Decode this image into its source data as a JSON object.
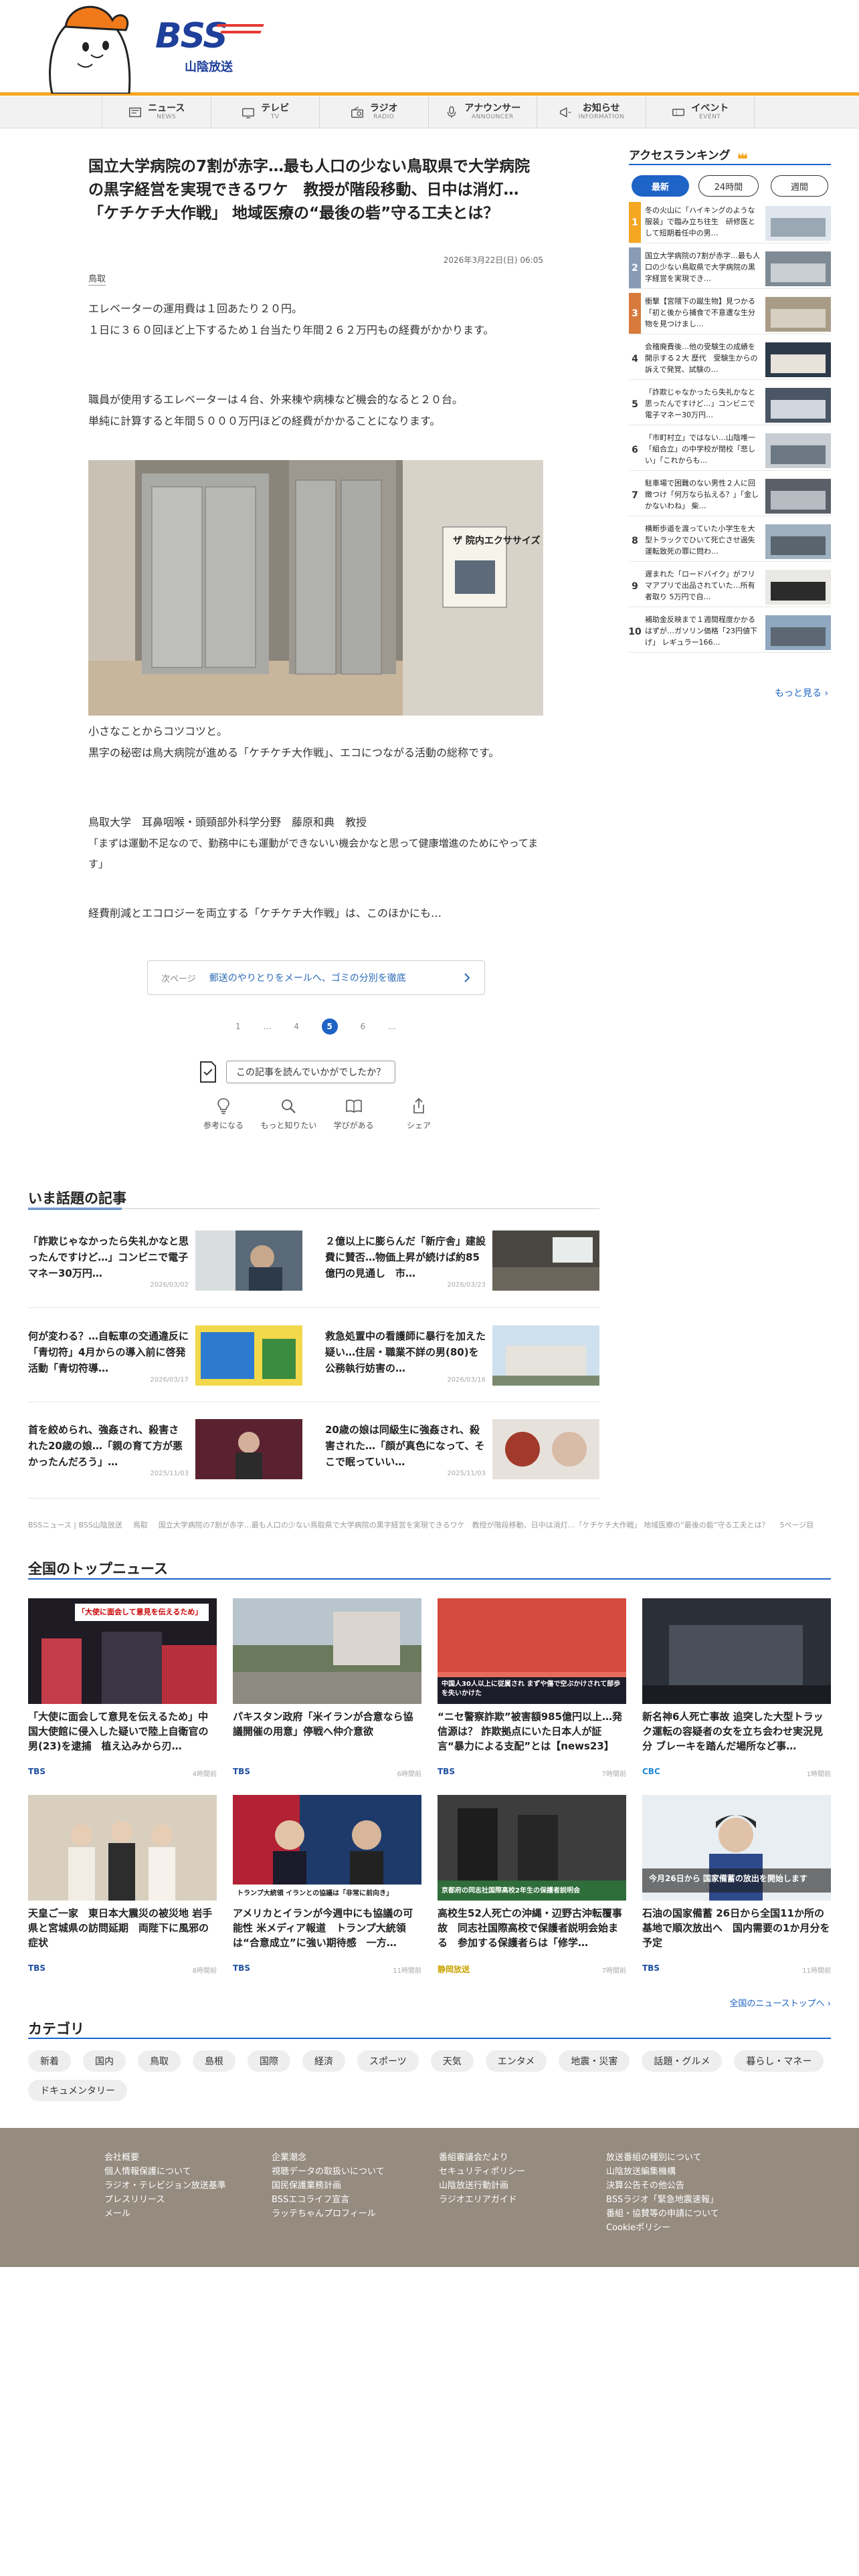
{
  "brand": {
    "name": "BSS",
    "sub": "山陰放送"
  },
  "nav": [
    {
      "label": "ニュース",
      "sub": "NEWS",
      "icon": "news-icon"
    },
    {
      "label": "テレビ",
      "sub": "TV",
      "icon": "tv-icon"
    },
    {
      "label": "ラジオ",
      "sub": "RADIO",
      "icon": "radio-icon"
    },
    {
      "label": "アナウンサー",
      "sub": "ANNOUNCER",
      "icon": "microphone-icon"
    },
    {
      "label": "お知らせ",
      "sub": "INFORMATION",
      "icon": "megaphone-icon"
    },
    {
      "label": "イベント",
      "sub": "EVENT",
      "icon": "ticket-icon"
    }
  ],
  "article": {
    "headline": "国立大学病院の7割が赤字…最も人口の少ない鳥取県で大学病院の黒字経営を実現できるワケ　教授が階段移動、日中は消灯…「ケチケチ大作戦」 地域医療の“最後の砦”守る工夫とは？",
    "date": "2026年3月22日(日) 06:05",
    "tag": "鳥取",
    "paragraphs": [
      "エレベーターの運用費は１回あたり２０円。",
      "１日に３６０回ほど上下するため１台当たり年間２６２万円もの経費がかかります。",
      "職員が使用するエレベーターは４台、外来棟や病棟など機会的なると２０台。",
      "単純に計算すると年間５０００万円ほどの経費がかかることになります。",
      "小さなことからコツコツと。",
      "黒字の秘密は鳥大病院が進める「ケチケチ大作戦」、エコにつながる活動の総称です。",
      "鳥取大学　耳鼻咽喉・頭頸部外科学分野　藤原和典　教授",
      "「まずは運動不足なので、勤務中にも運動ができないい機会かなと思って健康増進のためにやってます」",
      "経費削減とエコロジーを両立する「ケチケチ大作戦」は、このほかにも…"
    ],
    "photo_sign": "ザ 院内エクササイズ",
    "next_label": "次ページ",
    "next_title": "郵送のやりとりをメールへ、ゴミの分別を徹底",
    "pages": [
      "1",
      "…",
      "4",
      "5",
      "6",
      "…"
    ],
    "current_page": "5",
    "feedback_question": "この記事を読んでいかがでしたか？",
    "feedback": [
      {
        "label": "参考になる",
        "icon": "lightbulb-icon"
      },
      {
        "label": "もっと知りたい",
        "icon": "magnifier-icon"
      },
      {
        "label": "学びがある",
        "icon": "book-icon"
      },
      {
        "label": "シェア",
        "icon": "share-icon"
      }
    ]
  },
  "trending": {
    "title": "いま話題の記事",
    "items": [
      {
        "title": "「詐欺じゃなかったら失礼かなと思ったんですけど…」コンビニで電子マネー30万円…",
        "date": "2026/03/02"
      },
      {
        "title": "２億以上に膨らんだ「新庁舎」建設費に賛否…物価上昇が続けば約85億円の見通し　市…",
        "date": "2026/03/23"
      },
      {
        "title": "何が変わる？…自転車の交通違反に「青切符」4月からの導入前に啓発活動「青切符導…",
        "date": "2026/03/17"
      },
      {
        "title": "救急処置中の看護師に暴行を加えた疑い…住居・職業不詳の男(80)を公務執行妨害の…",
        "date": "2026/03/16"
      },
      {
        "title": "首を絞められ、強姦され、殺害された20歳の娘…「親の育て方が悪かったんだろう」…",
        "date": "2025/11/03"
      },
      {
        "title": "20歳の娘は同級生に強姦され、殺害された…「顔が真色になって、そこで眠っていい…",
        "date": "2025/11/03"
      }
    ]
  },
  "breadcrumb": [
    "BSSニュース | BSS山陰放送",
    "鳥取",
    "国立大学病院の7割が赤字…最も人口の少ない鳥取県で大学病院の黒字経営を実現できるワケ　教授が階段移動、日中は消灯…「ケチケチ大作戦」 地域医療の“最後の砦”守る工夫とは？",
    "5ページ目"
  ],
  "top_news": {
    "title": "全国のトップニュース",
    "more": "全国のニューストップへ ›",
    "items": [
      {
        "title": "「大使に面会して意見を伝えるため」中国大使館に侵入した疑いで陸上自衛官の男(23)を逮捕　植え込みから刃…",
        "source": "TBS",
        "time": "4時間前",
        "caption": "「大使に面会して意見を伝えるため」"
      },
      {
        "title": "パキスタン政府「米イランが合意なら協議開催の用意」停戦へ仲介意欲",
        "source": "TBS",
        "time": "6時間前",
        "caption": ""
      },
      {
        "title": "“ニセ警察詐欺”被害額985億円以上…発信源は？ 詐欺拠点にいた日本人が証言“暴力による支配”とは【news23】",
        "source": "TBS",
        "time": "7時間前",
        "caption": "中国人30人以上に従属され まずや傷で空ぶかけされて部歩を失いかけた"
      },
      {
        "title": "新名神6人死亡事故 追突した大型トラック運転の容疑者の女を立ち会わせ実況見分 ブレーキを踏んだ場所など事…",
        "source": "CBC",
        "time": "1時間前",
        "caption": ""
      },
      {
        "title": "天皇ご一家　東日本大震災の被災地 岩手県と宮城県の訪問延期　両陛下に風邪の症状",
        "source": "TBS",
        "time": "8時間前",
        "caption": ""
      },
      {
        "title": "アメリカとイランが今週中にも協議の可能性 米メディア報道　トランプ大統領は“合意成立”に強い期待感　一方…",
        "source": "TBS",
        "time": "11時間前",
        "caption": "トランプ大統領 イランとの協議は「非常に前向き」"
      },
      {
        "title": "高校生52人死亡の沖縄・辺野古沖転覆事故　同志社国際高校で保護者説明会始まる　参加する保護者らは「修学…",
        "source": "静岡放送",
        "time": "7時間前",
        "caption": "京都府の同志社国際高校2年生の保護者説明会"
      },
      {
        "title": "石油の国家備蓄 26日から全国11か所の基地で順次放出へ　国内需要の1か月分を予定",
        "source": "TBS",
        "time": "11時間前",
        "caption": "今月26日から 国家備蓄の放出を開始します"
      }
    ]
  },
  "categories": {
    "title": "カテゴリ",
    "items": [
      "新着",
      "国内",
      "鳥取",
      "島根",
      "国際",
      "経済",
      "スポーツ",
      "天気",
      "エンタメ",
      "地震・災害",
      "話題・グルメ",
      "暮らし・マネー",
      "ドキュメンタリー"
    ]
  },
  "footer": {
    "col1": [
      "会社概要",
      "個人情報保護について",
      "ラジオ・テレビジョン放送基準",
      "プレスリリース",
      "メール"
    ],
    "col2": [
      "企業潮念",
      "視聴データの取扱いについて",
      "国民保護業務計画",
      "BSSエコライフ宣言",
      "ラッテちゃんプロフィール"
    ],
    "col3": [
      "番組審議会だより",
      "セキュリティポリシー",
      "山陰放送行動計画",
      "ラジオエリアガイド"
    ],
    "col4": [
      "放送番組の種別について",
      "山陰放送編集機構",
      "決算公告その他公告",
      "BSSラジオ「緊急地震速報」",
      "番組・協賛等の申請について",
      "Cookieポリシー"
    ]
  },
  "ranking": {
    "title": "アクセスランキング",
    "tabs": [
      "最新",
      "24時間",
      "週間"
    ],
    "active_tab": "最新",
    "more": "もっと見る ›",
    "items": [
      {
        "rank": "1",
        "title": "冬の火山に「ハイキングのような服装」で臨み立ち往生　研修医として短期着任中の男…"
      },
      {
        "rank": "2",
        "title": "国立大学病院の7割が赤字…最も人口の少ない鳥取県で大学病院の黒字経営を実現でき…"
      },
      {
        "rank": "3",
        "title": "衝撃【宮隈下の蹴生物】見つかる「初と後から捕食で不意遭な生分物を見つけまし…"
      },
      {
        "rank": "4",
        "title": "会稽廃費後…他の受験生の成績を開示する２大 歴代　受験生からの訴えで発覚、試験の…"
      },
      {
        "rank": "5",
        "title": "「詐欺じゃなかったら失礼かなと思ったんですけど…」コンビニで電子マネー30万円…"
      },
      {
        "rank": "6",
        "title": "「市町村立」ではない…山陰唯一「組合立」の中学校が閉校「悲しい」「これからも…"
      },
      {
        "rank": "7",
        "title": "駐車場で困難のない男性２人に回緻つけ「何万なら払える？」「金しかないわね」 柴…"
      },
      {
        "rank": "8",
        "title": "横断歩道を渡っていた小学生を大型トラックでひいて死亡させ過失運転致死の罪に問わ…"
      },
      {
        "rank": "9",
        "title": "遅まれた「ロードバイク」がフリマアプリで出品されていた…所有者取り 5万円で自…"
      },
      {
        "rank": "10",
        "title": "補助金反映まで１週間程度かかるはずが…ガソリン価格「23円値下げ」 レギュラー166…"
      }
    ]
  },
  "colors": {
    "accent": "#1e63c6",
    "brand_orange": "#f5a623",
    "footer": "#958b7f"
  }
}
